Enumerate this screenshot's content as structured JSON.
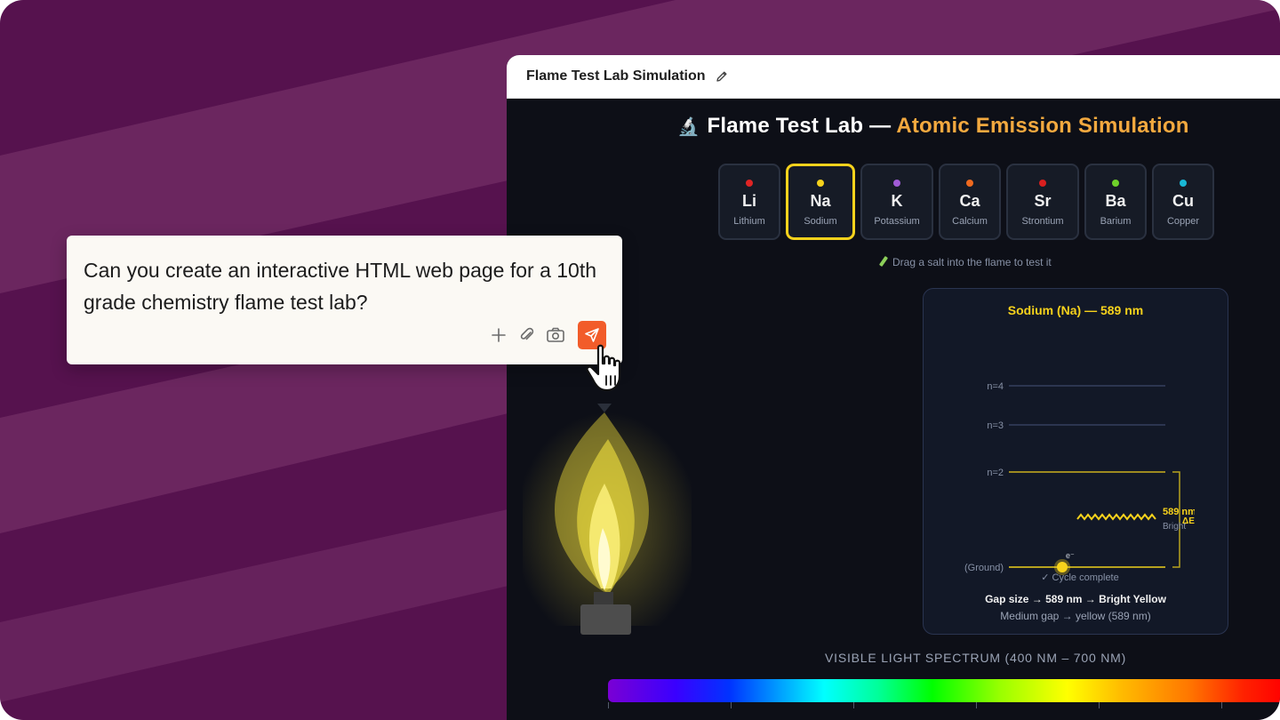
{
  "window": {
    "title": "Flame Test Lab Simulation"
  },
  "lab": {
    "heading_main": "Flame Test Lab —",
    "heading_accent": "Atomic Emission Simulation",
    "hint": "Drag a salt into the flame to test it",
    "elements": [
      {
        "symbol": "Li",
        "name": "Lithium",
        "dot_color": "#e02424"
      },
      {
        "symbol": "Na",
        "name": "Sodium",
        "dot_color": "#f7d21c",
        "selected": true
      },
      {
        "symbol": "K",
        "name": "Potassium",
        "dot_color": "#a05bd6"
      },
      {
        "symbol": "Ca",
        "name": "Calcium",
        "dot_color": "#f06a1f"
      },
      {
        "symbol": "Sr",
        "name": "Strontium",
        "dot_color": "#d91f1f"
      },
      {
        "symbol": "Ba",
        "name": "Barium",
        "dot_color": "#6fd12a"
      },
      {
        "symbol": "Cu",
        "name": "Copper",
        "dot_color": "#19b8d6"
      }
    ]
  },
  "energy_panel": {
    "title": "Sodium (Na) — 589 nm",
    "levels": [
      "n=4",
      "n=3",
      "n=2",
      "(Ground)"
    ],
    "electron_label": "e⁻",
    "cycle_status": "✓ Cycle complete",
    "photon_label": "589 nm",
    "delta_label": "ΔE",
    "brightness_label": "Bright",
    "gap_summary": "Gap size → 589 nm → Bright Yellow",
    "gap_detail": "Medium gap → yellow (589 nm)"
  },
  "spectrum": {
    "label": "VISIBLE LIGHT SPECTRUM (400 NM – 700 NM)"
  },
  "prompt": {
    "text": "Can you create an interactive HTML web page for a 10th grade chemistry flame test lab?"
  },
  "colors": {
    "accent": "#f3a93f",
    "sodium_yellow": "#f7d21c",
    "send_button": "#f25c2a",
    "background_purple": "#56124e"
  }
}
